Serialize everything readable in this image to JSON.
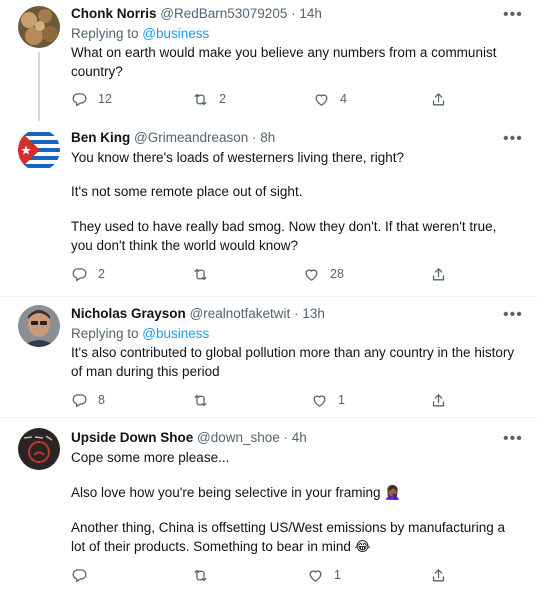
{
  "tweets": [
    {
      "name": "Chonk Norris",
      "handle": "@RedBarn53079205",
      "sep": " · ",
      "time": "14h",
      "reply_prefix": "Replying to ",
      "reply_to": "@business",
      "text": "What on earth would make you believe any numbers from a communist country?",
      "replies": "12",
      "retweets": "2",
      "likes": "4"
    },
    {
      "name": "Ben King",
      "handle": "@Grimeandreason",
      "sep": " · ",
      "time": "8h",
      "paragraphs": [
        "You know there's loads of westerners living there, right?",
        "It's not some remote place out of sight.",
        "They used to have really bad smog. Now they don't. If that weren't true, you don't think the world would know?"
      ],
      "replies": "2",
      "retweets": "",
      "likes": "28"
    },
    {
      "name": "Nicholas Grayson",
      "handle": "@realnotfaketwit",
      "sep": " · ",
      "time": "13h",
      "reply_prefix": "Replying to ",
      "reply_to": "@business",
      "text": "It's also contributed to global pollution more than any country in the history of man during this period",
      "replies": "8",
      "retweets": "",
      "likes": "1"
    },
    {
      "name": "Upside Down Shoe",
      "handle": "@down_shoe",
      "sep": " · ",
      "time": "4h",
      "paragraphs": [
        "Cope some more please...",
        "Also love how you're being selective in your framing 🤦🏾‍♀️",
        "Another thing, China is offsetting US/West emissions by manufacturing a lot of their products. Something to bear in mind 😂"
      ],
      "replies": "",
      "retweets": "",
      "likes": "1"
    }
  ],
  "more_glyph": "•••",
  "colors": {
    "link": "#1d9bf0",
    "secondary": "#536471",
    "text": "#0f1419",
    "divider": "#eff3f4"
  },
  "icons": [
    "reply-icon",
    "retweet-icon",
    "like-icon",
    "share-icon",
    "more-icon"
  ]
}
